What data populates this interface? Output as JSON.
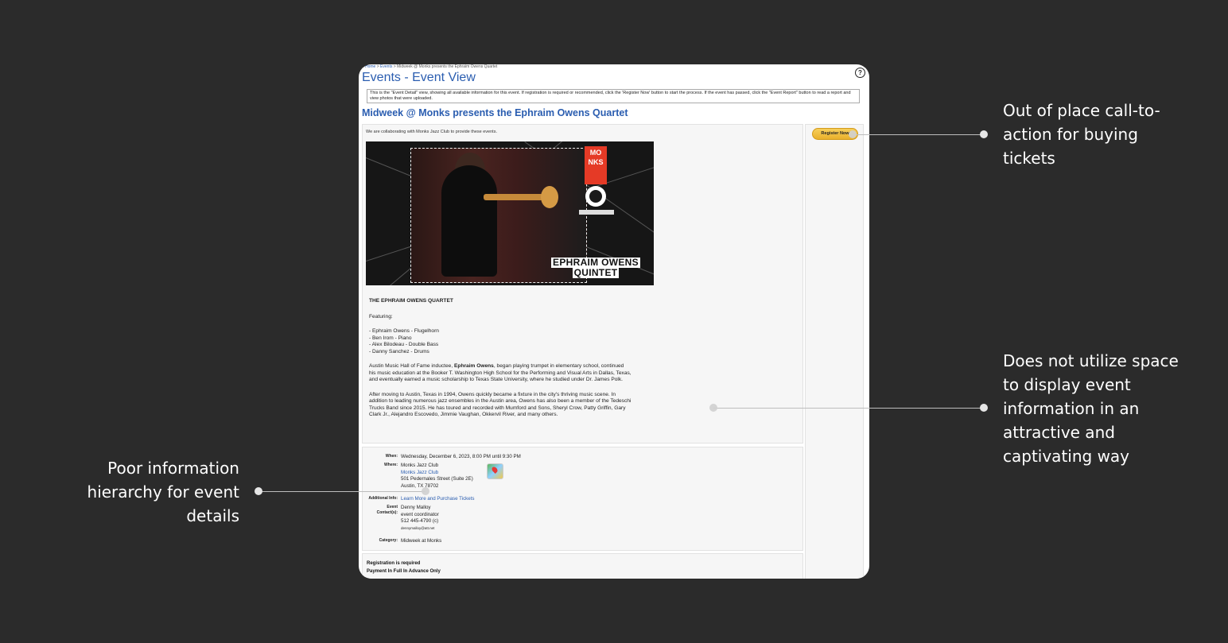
{
  "annotations": {
    "cta": [
      "Out of place call-to-",
      "action for buying",
      "tickets"
    ],
    "space": [
      "Does not utilize space",
      "to display event",
      "information in an",
      "attractive and",
      "captivating way"
    ],
    "hierarchy": [
      "Poor information",
      "hierarchy for event",
      "details"
    ]
  },
  "page": {
    "breadcrumb": {
      "home": "Home",
      "sep1": " > ",
      "events": "Events",
      "sep2": " > ",
      "current": "Midweek @ Monks presents the Ephraim Owens Quartet"
    },
    "help": "?",
    "title": "Events - Event View",
    "info": "This is the \"Event Detail\" view, showing all available information for this event. If registration is required or recommended, click the 'Register Now' button to start the process. If the event has passed, click the \"Event Report\" button to read a report and view photos that were uploaded.",
    "event_title": "Midweek @ Monks presents the Ephraim Owens Quartet",
    "register_button": "Register Now",
    "collab": "We are collaborating with Monks Jazz Club to provide these events.",
    "poster": {
      "logo": "MO NKS",
      "name_line1": "EPHRAIM OWENS",
      "name_line2": "QUINTET"
    },
    "bio": {
      "heading": "THE EPHRAIM OWENS QUARTET",
      "featuring": "Featuring:",
      "members": [
        "- Ephraim Owens - Flugelhorn",
        "- Ben Irom - Piano",
        "- Alex Bilodeau - Double Bass",
        "- Danny Sanchez - Drums"
      ],
      "p1_before": "Austin Music Hall of Fame inductee, ",
      "p1_bold": "Ephraim Owens",
      "p1_after": ", began playing trumpet in elementary school, continued his music education at the Booker T. Washington High School for the Performing and Visual Arts in Dallas, Texas, and eventually earned a music scholarship to Texas State University, where he studied under Dr. James Polk.",
      "p2": "After moving to Austin, Texas in 1994, Owens quickly became a fixture in the city's thriving music scene. In addition to leading numerous jazz ensembles in the Austin area, Owens has also been a member of the Tedeschi Trucks Band since 2015. He has toured and recorded with Mumford and Sons, Sheryl Crow, Patty Griffin, Gary Clark Jr., Alejandro Escovedo, Jimmie Vaughan, Okkervil River, and many others."
    },
    "details": {
      "when_label": "When:",
      "when": "Wednesday, December 6, 2023, 8:00 PM until 9:30 PM",
      "where_label": "Where:",
      "venue": "Monks Jazz Club",
      "venue_link": "Monks Jazz Club",
      "street": "501 Pedernales Street (Suite 2E)",
      "city": "Austin, TX  78702",
      "additional_label": "Additional Info:",
      "additional_link": "Learn More and Purchase Tickets",
      "contact_label_1": "Event",
      "contact_label_2": "Contact(s):",
      "contact_name": "Denny Malloy",
      "contact_role": "event coordinator",
      "contact_phone": "512 445-4790 (c)",
      "contact_email": "dennymalloy@att.net",
      "category_label": "Category:",
      "category": "Midweek at Monks"
    },
    "registration": {
      "required": "Registration is required",
      "payment": "Payment In Full In Advance Only"
    }
  }
}
